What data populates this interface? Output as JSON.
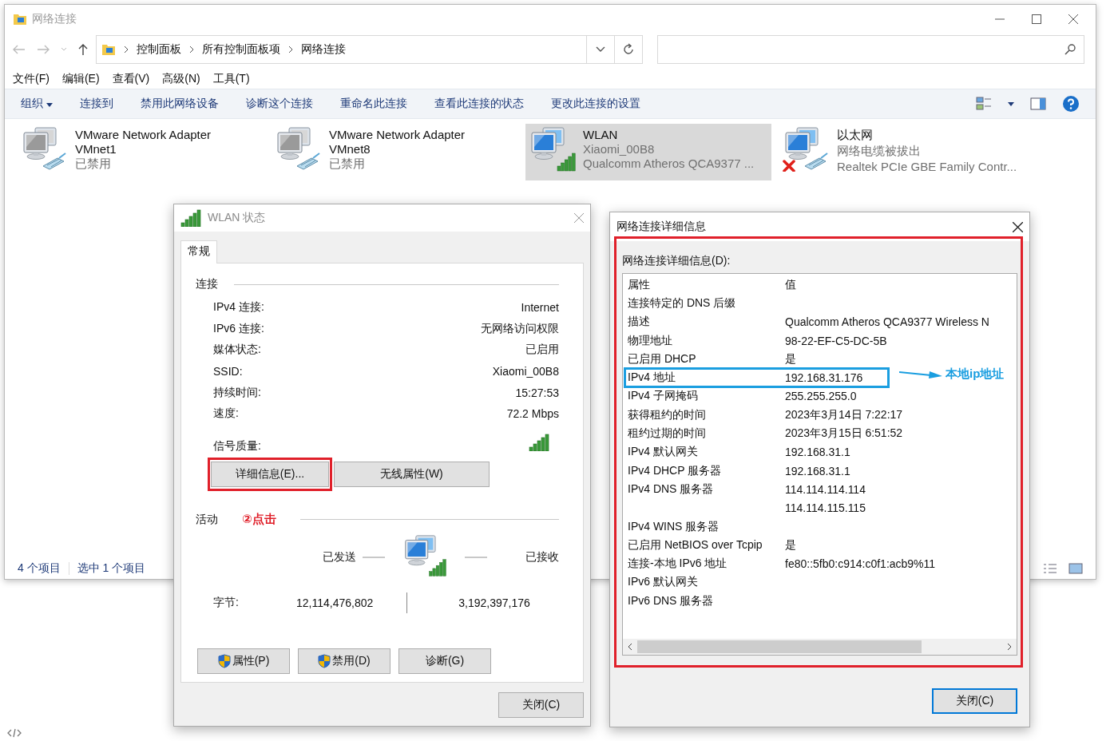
{
  "explorer": {
    "title": "网络连接",
    "breadcrumbs": [
      "控制面板",
      "所有控制面板项",
      "网络连接"
    ],
    "menu": [
      "文件(F)",
      "编辑(E)",
      "查看(V)",
      "高级(N)",
      "工具(T)"
    ],
    "commands": [
      "组织",
      "连接到",
      "禁用此网络设备",
      "诊断这个连接",
      "重命名此连接",
      "查看此连接的状态",
      "更改此连接的设置"
    ],
    "adapters": [
      {
        "kind": "disabled",
        "lines": [
          "VMware Network Adapter",
          "VMnet1",
          "已禁用"
        ],
        "selected": false
      },
      {
        "kind": "disabled",
        "lines": [
          "VMware Network Adapter",
          "VMnet8",
          "已禁用"
        ],
        "selected": false
      },
      {
        "kind": "wireless",
        "lines": [
          "WLAN",
          "Xiaomi_00B8",
          "Qualcomm Atheros QCA9377 ..."
        ],
        "selected": true
      },
      {
        "kind": "unplugged",
        "lines": [
          "以太网",
          "网络电缆被拔出",
          "Realtek PCIe GBE Family Contr..."
        ],
        "selected": false
      }
    ],
    "status_bar": [
      "4 个项目",
      "选中 1 个项目"
    ]
  },
  "wlan_dialog": {
    "title": "WLAN 状态",
    "tabs": [
      {
        "label": "常规",
        "selected": true
      }
    ],
    "connection_heading": "连接",
    "fields": [
      {
        "label": "IPv4 连接:",
        "value": "Internet"
      },
      {
        "label": "IPv6 连接:",
        "value": "无网络访问权限"
      },
      {
        "label": "媒体状态:",
        "value": "已启用"
      },
      {
        "label": "SSID:",
        "value": "Xiaomi_00B8"
      },
      {
        "label": "持续时间:",
        "value": "15:27:53"
      },
      {
        "label": "速度:",
        "value": "72.2 Mbps"
      }
    ],
    "signal_label": "信号质量:",
    "buttons": [
      {
        "label": "详细信息(E)...",
        "highlighted": true
      },
      {
        "label": "无线属性(W)",
        "highlighted": false
      }
    ],
    "activity_heading": "活动",
    "annotation": "②点击",
    "sent_label": "已发送",
    "received_label": "已接收",
    "bytes_label": "字节:",
    "bytes_sent": "12,114,476,802",
    "bytes_received": "3,192,397,176",
    "action_buttons": [
      {
        "label": "属性(P)",
        "shield": true
      },
      {
        "label": "禁用(D)",
        "shield": true
      },
      {
        "label": "诊断(G)",
        "shield": false
      }
    ],
    "close_button": "关闭(C)"
  },
  "details_dialog": {
    "title": "网络连接详细信息",
    "highlighted": true,
    "list_label": "网络连接详细信息(D):",
    "columns": [
      "属性",
      "值"
    ],
    "rows": [
      {
        "property": "连接特定的 DNS 后缀",
        "value": "",
        "highlighted": false
      },
      {
        "property": "描述",
        "value": "Qualcomm Atheros QCA9377 Wireless N",
        "highlighted": false
      },
      {
        "property": "物理地址",
        "value": "98-22-EF-C5-DC-5B",
        "highlighted": false
      },
      {
        "property": "已启用 DHCP",
        "value": "是",
        "highlighted": false
      },
      {
        "property": "IPv4 地址",
        "value": "192.168.31.176",
        "highlighted": true,
        "callout": "本地ip地址"
      },
      {
        "property": "IPv4 子网掩码",
        "value": "255.255.255.0",
        "highlighted": false
      },
      {
        "property": "获得租约的时间",
        "value": "2023年3月14日 7:22:17",
        "highlighted": false
      },
      {
        "property": "租约过期的时间",
        "value": "2023年3月15日 6:51:52",
        "highlighted": false
      },
      {
        "property": "IPv4 默认网关",
        "value": "192.168.31.1",
        "highlighted": false
      },
      {
        "property": "IPv4 DHCP 服务器",
        "value": "192.168.31.1",
        "highlighted": false
      },
      {
        "property": "IPv4 DNS 服务器",
        "value": "114.114.114.114",
        "highlighted": false
      },
      {
        "property": "",
        "value": "114.114.115.115",
        "highlighted": false
      },
      {
        "property": "IPv4 WINS 服务器",
        "value": "",
        "highlighted": false
      },
      {
        "property": "已启用 NetBIOS over Tcpip",
        "value": "是",
        "highlighted": false
      },
      {
        "property": "连接-本地 IPv6 地址",
        "value": "fe80::5fb0:c914:c0f1:acb9%11",
        "highlighted": false
      },
      {
        "property": "IPv6 默认网关",
        "value": "",
        "highlighted": false
      },
      {
        "property": "IPv6 DNS 服务器",
        "value": "",
        "highlighted": false
      }
    ],
    "close_button": "关闭(C)"
  }
}
